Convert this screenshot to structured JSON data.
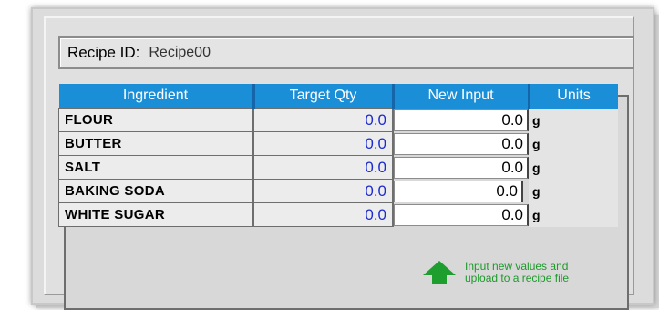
{
  "recipe": {
    "label": "Recipe ID:",
    "value": "Recipe00"
  },
  "table": {
    "headers": [
      "Ingredient",
      "Target Qty",
      "New Input",
      "Units"
    ],
    "rows": [
      {
        "ingredient": "FLOUR",
        "target": "0.0",
        "input": "0.0",
        "unit": "g"
      },
      {
        "ingredient": "BUTTER",
        "target": "0.0",
        "input": "0.0",
        "unit": "g"
      },
      {
        "ingredient": "SALT",
        "target": "0.0",
        "input": "0.0",
        "unit": "g"
      },
      {
        "ingredient": "BAKING SODA",
        "target": "0.0",
        "input": "0.0",
        "unit": "g"
      },
      {
        "ingredient": "WHITE SUGAR",
        "target": "0.0",
        "input": "0.0",
        "unit": "g"
      }
    ]
  },
  "hint": {
    "line1": "Input new values and",
    "line2": "upload to a recipe file",
    "icon": "up-arrow-icon"
  },
  "colors": {
    "header_bg": "#1a8fd8",
    "target_value": "#1c2bd0",
    "hint_text": "#1c9a2a",
    "arrow": "#1e9e2e"
  }
}
